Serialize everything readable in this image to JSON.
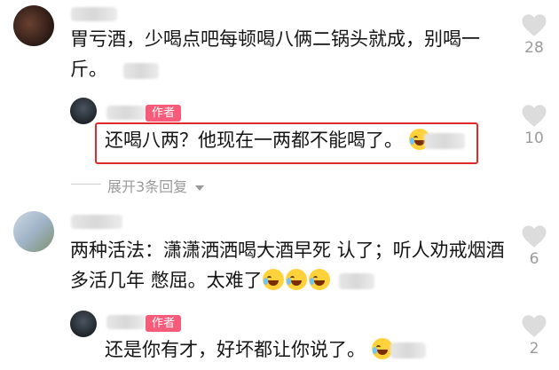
{
  "comments": [
    {
      "text_line1": "胃亏酒，少喝点吧每顿喝八俩二锅头就成，别喝一",
      "text_line2": "斤。",
      "likes": "28"
    },
    {
      "author_badge": "作者",
      "text": "还喝八两？他现在一两都不能喝了。",
      "likes": "10"
    },
    {
      "expand_label": "展开3条回复"
    },
    {
      "text_line1": "两种活法：潇潇洒洒喝大酒早死 认了；听人劝戒烟酒",
      "text_line2": "多活几年 憋屈。太难了",
      "likes": "6"
    },
    {
      "author_badge": "作者",
      "text": "还是你有才，好坏都让你说了。",
      "likes": "2"
    }
  ],
  "colors": {
    "author_badge": "#f85b7a",
    "highlight_border": "#e02a2a",
    "muted_text": "#9a9a9a"
  },
  "icons": {
    "like": "heart-icon",
    "expand": "chevron-down-icon",
    "emoji": "laughing-crying-emoji-icon"
  }
}
